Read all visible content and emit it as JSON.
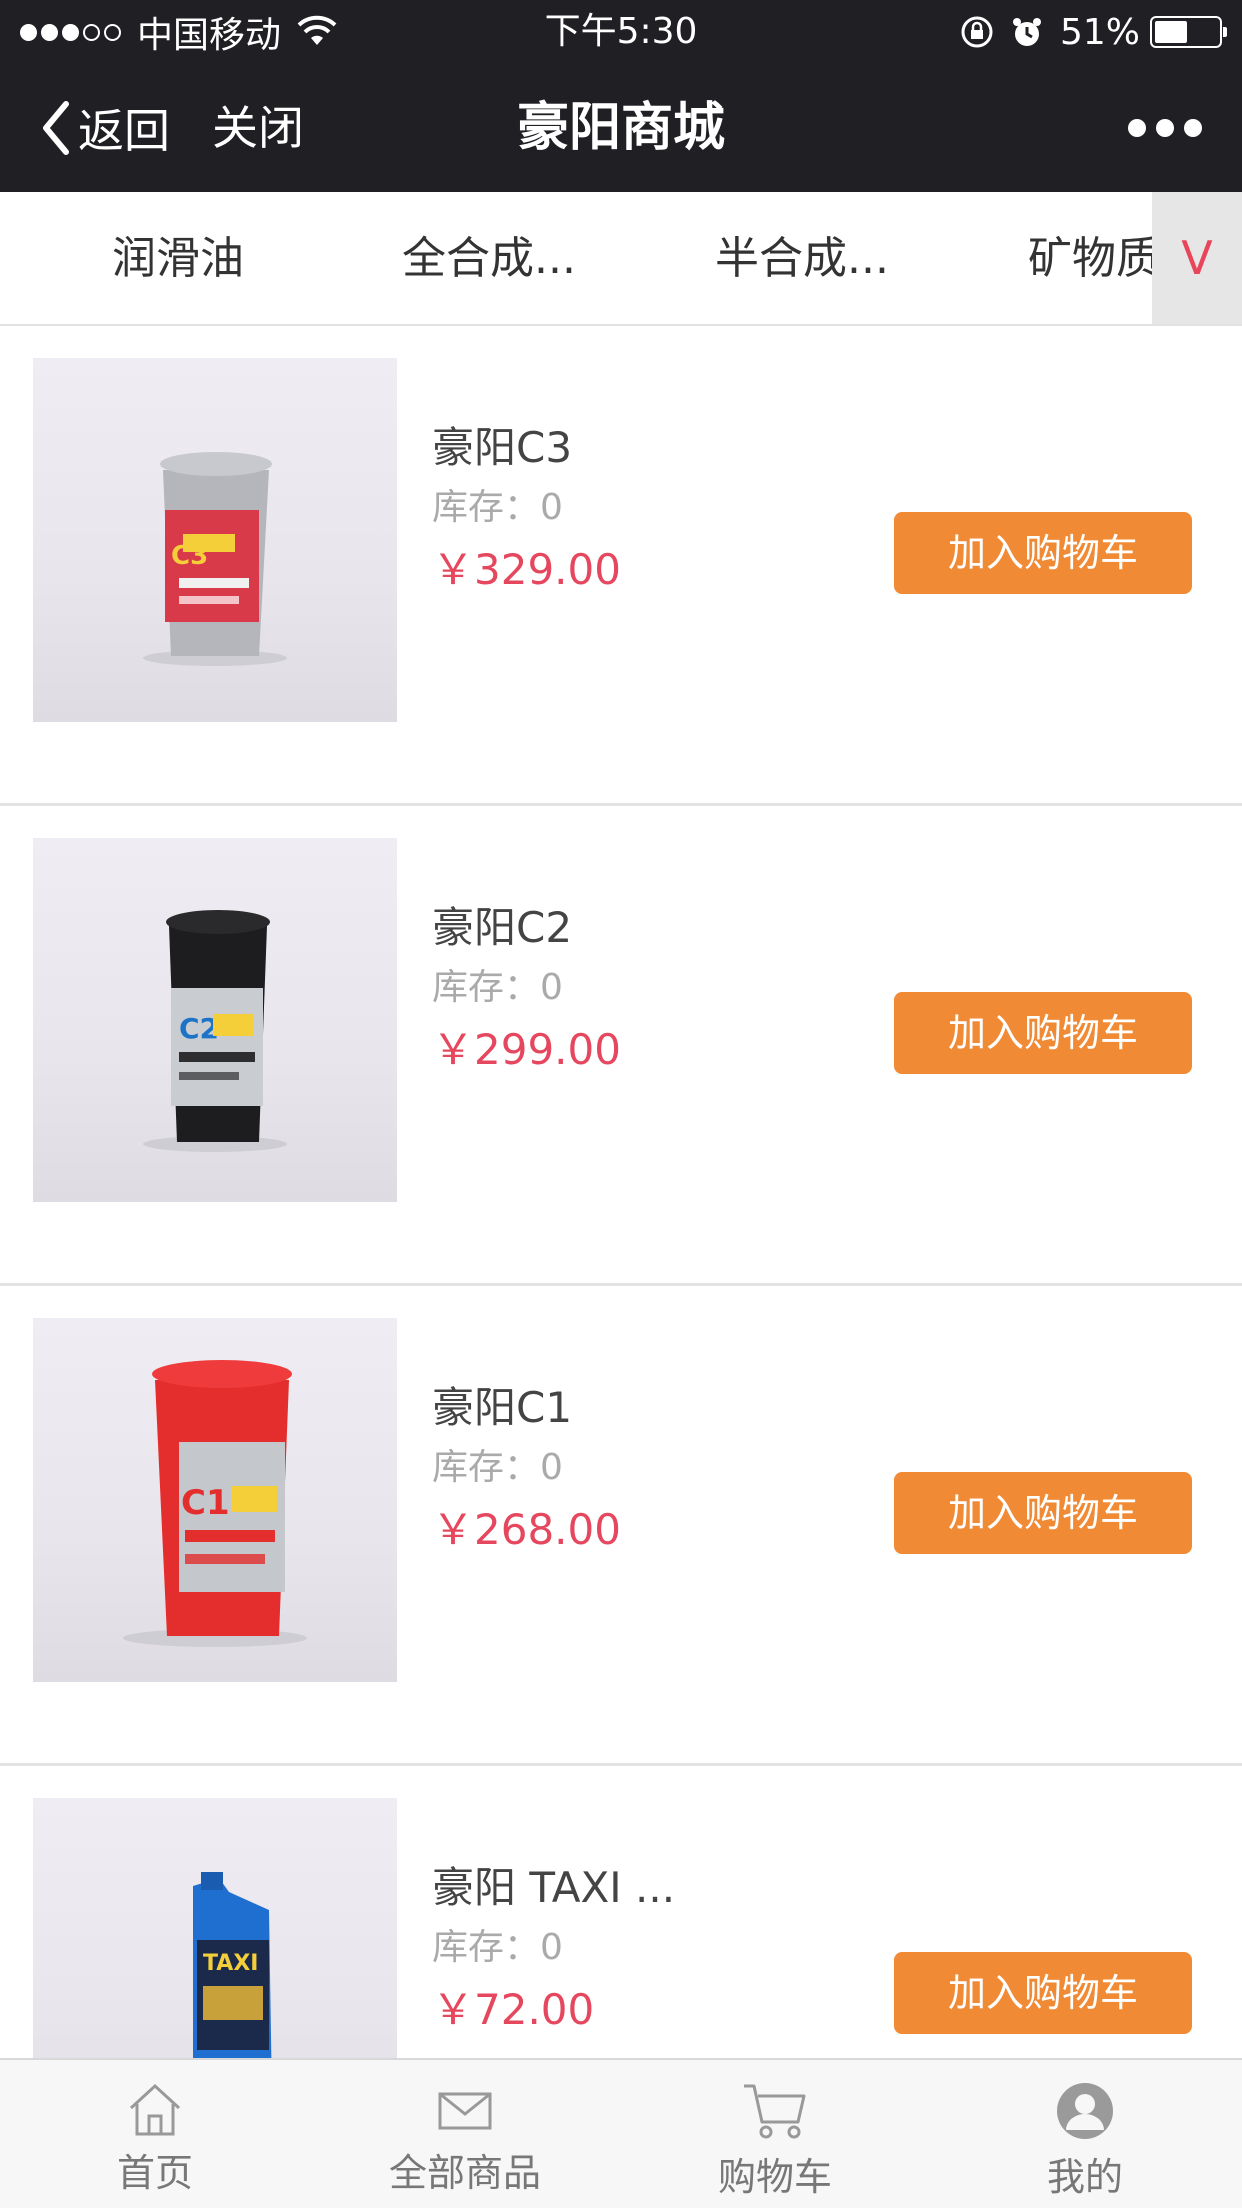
{
  "status_bar": {
    "carrier": "中国移动",
    "time": "下午5:30",
    "battery_text": "51%",
    "battery_level": 0.51,
    "signal_bars_filled": 3,
    "signal_bars_total": 5
  },
  "nav": {
    "back_label": "返回",
    "close_label": "关闭",
    "title": "豪阳商城"
  },
  "categories": {
    "tabs": [
      "润滑油",
      "全合成...",
      "半合成...",
      "矿物质"
    ],
    "expand_label": "V"
  },
  "products": [
    {
      "name": "豪阳C3",
      "stock": "库存：0",
      "price": "￥329.00",
      "button": "加入购物车"
    },
    {
      "name": "豪阳C2",
      "stock": "库存：0",
      "price": "￥299.00",
      "button": "加入购物车"
    },
    {
      "name": "豪阳C1",
      "stock": "库存：0",
      "price": "￥268.00",
      "button": "加入购物车"
    },
    {
      "name": "豪阳 TAXI ...",
      "stock": "库存：0",
      "price": "￥72.00",
      "button": "加入购物车"
    }
  ],
  "tabbar": {
    "items": [
      {
        "label": "首页",
        "icon": "home-icon"
      },
      {
        "label": "全部商品",
        "icon": "envelope-icon"
      },
      {
        "label": "购物车",
        "icon": "cart-icon"
      },
      {
        "label": "我的",
        "icon": "user-icon"
      }
    ]
  },
  "colors": {
    "bar_bg": "#1f1f24",
    "accent_orange": "#f08a35",
    "price_red": "#e5475e"
  }
}
